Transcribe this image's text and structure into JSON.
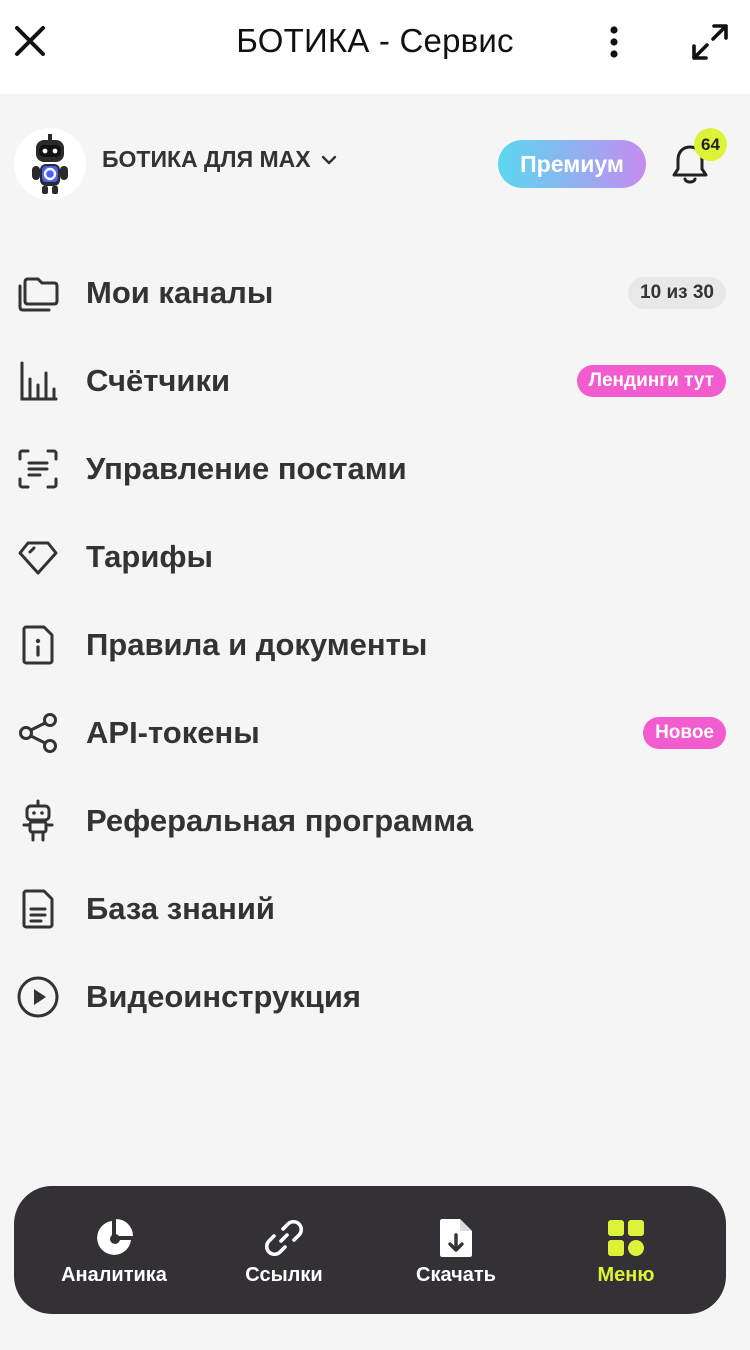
{
  "header": {
    "title": "БОТИКА - Сервис",
    "close_icon": "close-icon",
    "more_icon": "more-vertical-icon",
    "expand_icon": "expand-icon"
  },
  "account": {
    "name": "БОТИКА ДЛЯ MAX",
    "premium_label": "Премиум",
    "notifications_count": "64"
  },
  "menu": {
    "items": [
      {
        "label": "Мои каналы",
        "icon": "folders-icon",
        "badge": "10 из 30"
      },
      {
        "label": "Счётчики",
        "icon": "bar-chart-icon",
        "badge": "Лендинги тут"
      },
      {
        "label": "Управление постами",
        "icon": "scan-text-icon",
        "badge": ""
      },
      {
        "label": "Тарифы",
        "icon": "diamond-icon",
        "badge": ""
      },
      {
        "label": "Правила и документы",
        "icon": "info-document-icon",
        "badge": ""
      },
      {
        "label": "API-токены",
        "icon": "share-icon",
        "badge": "Новое"
      },
      {
        "label": "Реферальная программа",
        "icon": "robot-icon",
        "badge": ""
      },
      {
        "label": "База знаний",
        "icon": "document-icon",
        "badge": ""
      },
      {
        "label": "Видеоинструкция",
        "icon": "play-circle-icon",
        "badge": ""
      }
    ]
  },
  "bottom_nav": {
    "items": [
      {
        "label": "Аналитика",
        "icon": "pie-chart-icon"
      },
      {
        "label": "Ссылки",
        "icon": "link-icon"
      },
      {
        "label": "Скачать",
        "icon": "file-download-icon"
      },
      {
        "label": "Меню",
        "icon": "grid-icon"
      }
    ],
    "active": "Меню"
  },
  "colors": {
    "accent": "#def239",
    "pink": "#f25ccf",
    "nav_bg": "#333135",
    "premium_from": "#5ad8f0",
    "premium_to": "#c48cf0"
  }
}
